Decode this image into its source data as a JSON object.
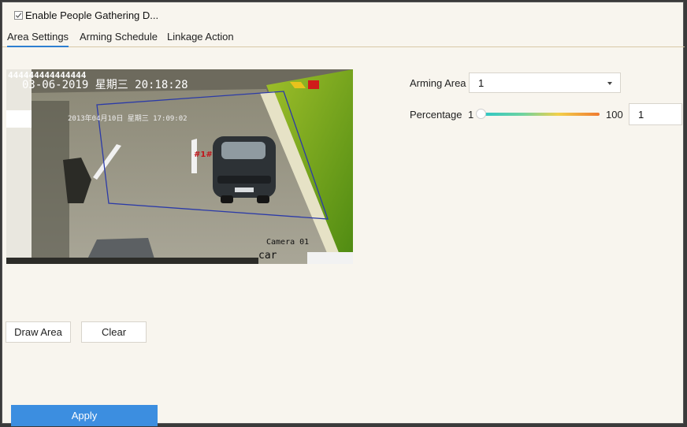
{
  "enable": {
    "label": "Enable People Gathering D...",
    "checked": true
  },
  "tabs": [
    {
      "label": "Area Settings",
      "active": true
    },
    {
      "label": "Arming Schedule",
      "active": false
    },
    {
      "label": "Linkage Action",
      "active": false
    }
  ],
  "video": {
    "osd_top": "444444444444444",
    "osd_datetime": "03-06-2019  星期三  20:18:28",
    "inner_datetime": "2013年04月10日  星期三  17:09:02",
    "zone_label": "#1#",
    "camera_label": "Camera 01",
    "bottom_text": "car"
  },
  "buttons": {
    "draw_area": "Draw Area",
    "clear": "Clear",
    "apply": "Apply"
  },
  "arming_area": {
    "label": "Arming Area",
    "value": "1"
  },
  "percentage": {
    "label": "Percentage",
    "min": "1",
    "max": "100",
    "value": "1"
  }
}
